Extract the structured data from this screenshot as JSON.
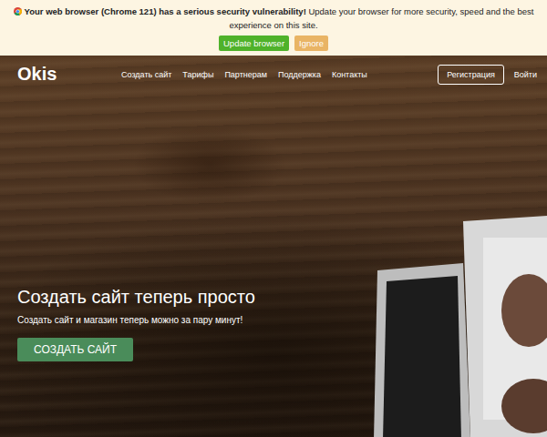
{
  "banner": {
    "alert": "Your web browser (Chrome 121) has a serious security vulnerability!",
    "message": "Update your browser for more security, speed and the best experience on this site.",
    "buttons": [
      "Update browser",
      "Ignore"
    ]
  },
  "nav": {
    "logo": "Okis",
    "links": [
      "Создать сайт",
      "Тарифы",
      "Партнерам",
      "Поддержка",
      "Контакты"
    ],
    "register": "Регистрация",
    "login": "Войти"
  },
  "hero": {
    "title": "Создать сайт теперь просто",
    "subtitle": "Создать сайт и магазин теперь можно за пару минут!",
    "cta": "СОЗДАТЬ САЙТ"
  }
}
